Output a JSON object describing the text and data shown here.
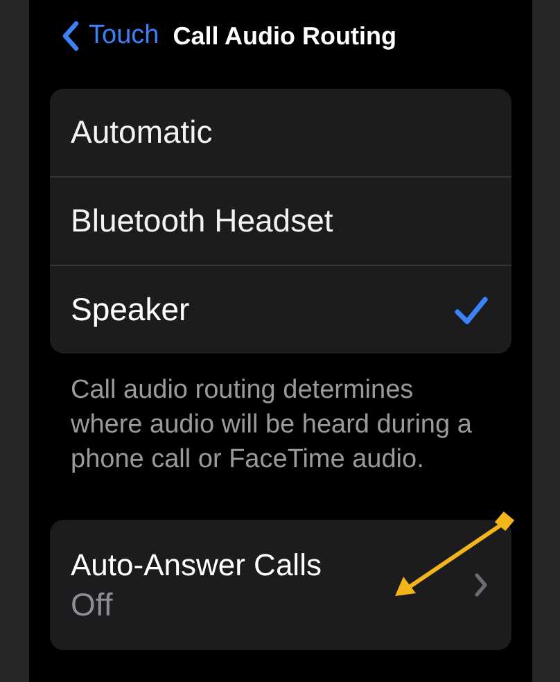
{
  "nav": {
    "back_label": "Touch",
    "title": "Call Audio Routing"
  },
  "options": [
    {
      "label": "Automatic",
      "selected": false
    },
    {
      "label": "Bluetooth Headset",
      "selected": false
    },
    {
      "label": "Speaker",
      "selected": true
    }
  ],
  "footer": "Call audio routing determines where audio will be heard during a phone call or FaceTime audio.",
  "auto_answer": {
    "label": "Auto-Answer Calls",
    "value": "Off"
  }
}
